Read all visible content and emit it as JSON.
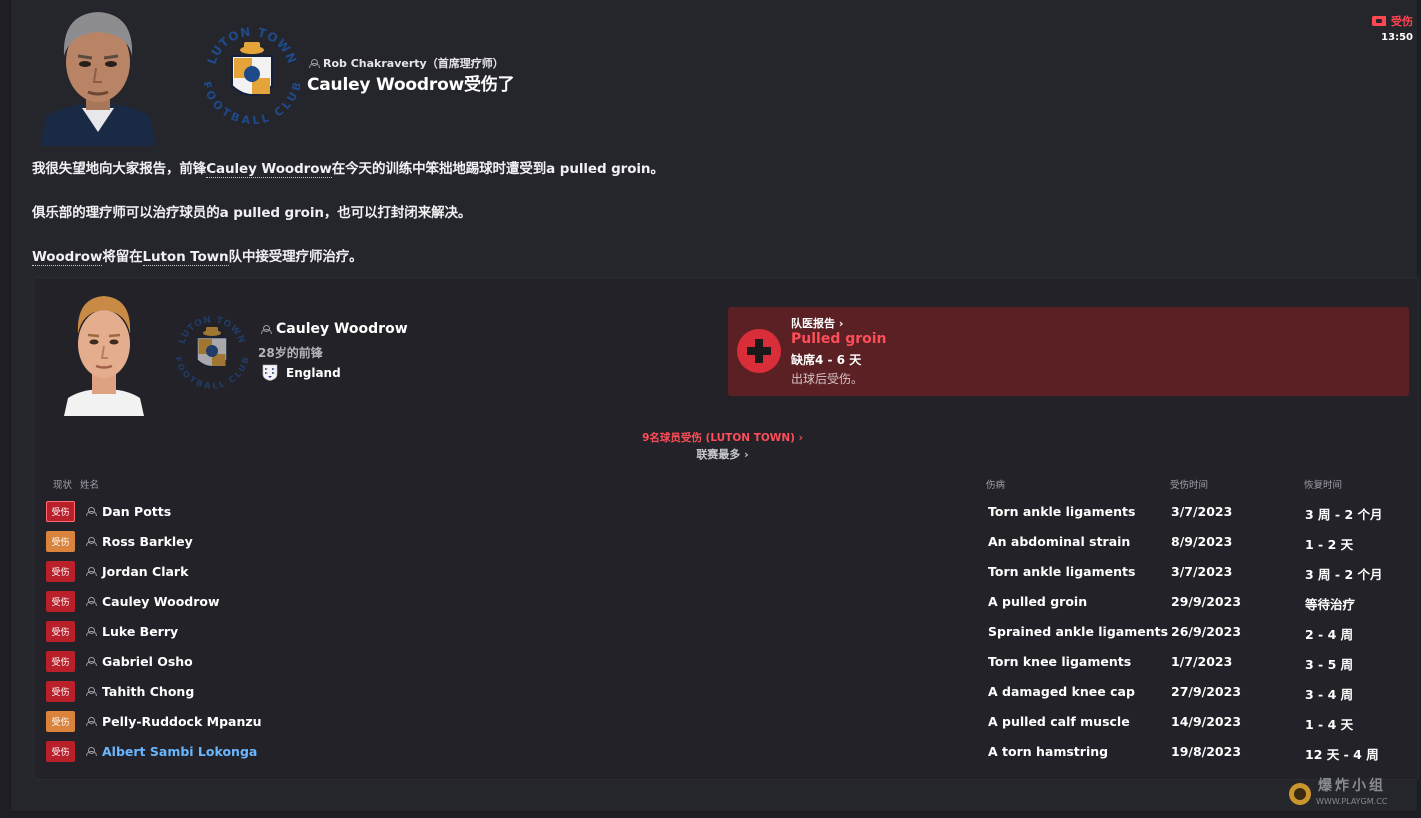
{
  "header": {
    "sender_name": "Rob Chakraverty（首席理疗师）",
    "headline": "Cauley Woodrow受伤了",
    "tag_label": "受伤",
    "time": "13:50"
  },
  "club_logo_text": {
    "top": "LUTON TOWN",
    "bottom": "FOOTBALL CLUB"
  },
  "body": {
    "p1_a": "我很失望地向大家报告，前锋",
    "p1_link": "Cauley Woodrow",
    "p1_b": "在今天的训练中笨拙地踢球时遭受到a pulled groin。",
    "p2": "俱乐部的理疗师可以治疗球员的a pulled groin，也可以打封闭来解决。",
    "p3_link1": "Woodrow",
    "p3_a": "将留在",
    "p3_link2": "Luton Town",
    "p3_b": "队中接受理疗师治疗。"
  },
  "player": {
    "name": "Cauley Woodrow",
    "description": "28岁的前锋",
    "nation": "England"
  },
  "medical": {
    "title": "队医报告 ›",
    "injury": "Pulled groin",
    "duration": "缺席4 - 6 天",
    "note": "出球后受伤。"
  },
  "links": {
    "count": "9名球员受伤 (LUTON TOWN) ›",
    "most": "联赛最多 ›"
  },
  "table": {
    "headers": {
      "status": "现状",
      "name": "姓名",
      "injury": "伤病",
      "date": "受伤时间",
      "recovery": "恢复时间"
    },
    "rows": [
      {
        "status": "受伤",
        "status_color": "#b9202a",
        "name": "Dan Potts",
        "injury": "Torn ankle ligaments",
        "date": "3/7/2023",
        "recovery": "3 周 - 2 个月"
      },
      {
        "status": "受伤",
        "status_color": "#d9833c",
        "name": "Ross Barkley",
        "injury": "An abdominal strain",
        "date": "8/9/2023",
        "recovery": "1 - 2 天"
      },
      {
        "status": "受伤",
        "status_color": "#b9202a",
        "name": "Jordan Clark",
        "injury": "Torn ankle ligaments",
        "date": "3/7/2023",
        "recovery": "3 周 - 2 个月"
      },
      {
        "status": "受伤",
        "status_color": "#b9202a",
        "name": "Cauley Woodrow",
        "injury": "A pulled groin",
        "date": "29/9/2023",
        "recovery": "等待治疗"
      },
      {
        "status": "受伤",
        "status_color": "#b9202a",
        "name": "Luke Berry",
        "injury": "Sprained ankle ligaments",
        "date": "26/9/2023",
        "recovery": "2 - 4 周"
      },
      {
        "status": "受伤",
        "status_color": "#b9202a",
        "name": "Gabriel Osho",
        "injury": "Torn knee ligaments",
        "date": "1/7/2023",
        "recovery": "3 - 5 周"
      },
      {
        "status": "受伤",
        "status_color": "#b9202a",
        "name": "Tahith Chong",
        "injury": "A damaged knee cap",
        "date": "27/9/2023",
        "recovery": "3 - 4 周"
      },
      {
        "status": "受伤",
        "status_color": "#d9833c",
        "name": "Pelly-Ruddock Mpanzu",
        "injury": "A pulled calf muscle",
        "date": "14/9/2023",
        "recovery": "1 - 4 天"
      },
      {
        "status": "受伤",
        "status_color": "#b9202a",
        "name": "Albert Sambi Lokonga",
        "injury": "A torn hamstring",
        "date": "19/8/2023",
        "recovery": "12 天 - 4 周"
      }
    ]
  },
  "watermark": {
    "text": "爆炸小组",
    "url": "WWW.PLAYGM.CC"
  }
}
